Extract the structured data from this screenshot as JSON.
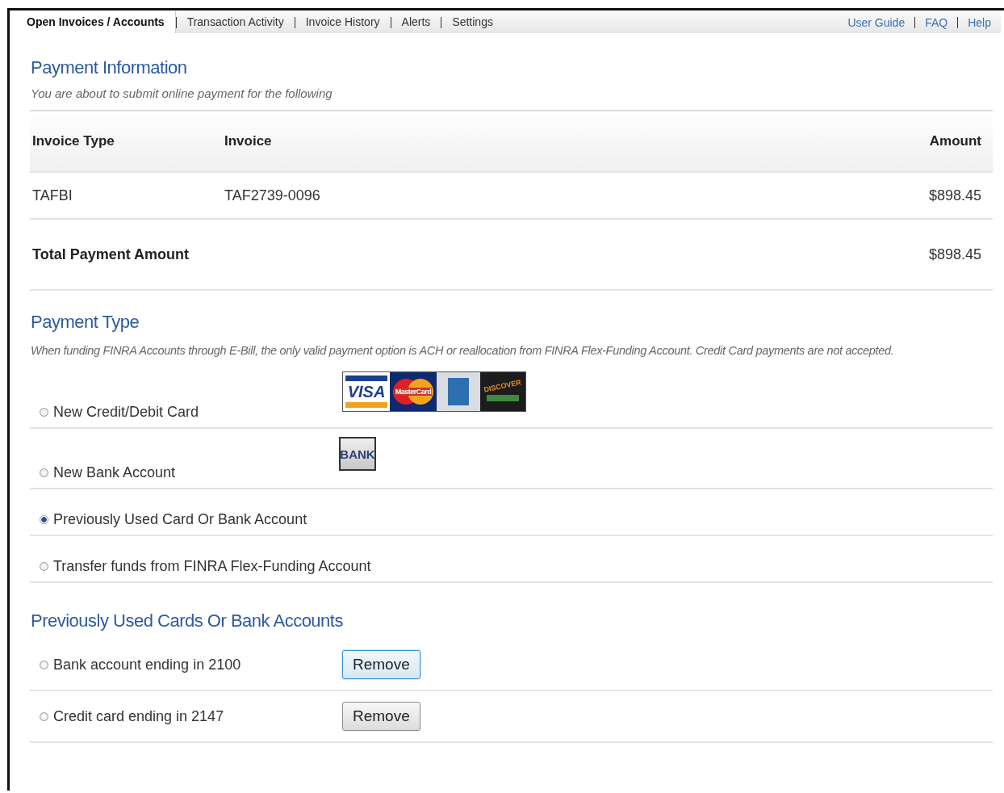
{
  "tabs": [
    {
      "label": "Open Invoices / Accounts",
      "selected": true
    },
    {
      "label": "Transaction Activity",
      "selected": false
    },
    {
      "label": "Invoice History",
      "selected": false
    },
    {
      "label": "Alerts",
      "selected": false
    },
    {
      "label": "Settings",
      "selected": false
    }
  ],
  "help_links": [
    "User Guide",
    "FAQ",
    "Help"
  ],
  "payment_information": {
    "title": "Payment Information",
    "subtitle": "You are about to submit online payment for the following",
    "table": {
      "columns": [
        "Invoice Type",
        "Invoice",
        "Amount"
      ],
      "rows": [
        [
          "TAFBI",
          "TAF2739-0096",
          "$898.45"
        ]
      ],
      "total": {
        "label": "Total Payment Amount",
        "amount": "$898.45"
      }
    }
  },
  "payment_type": {
    "title": "Payment Type",
    "note": "When funding FINRA Accounts through E-Bill, the only valid payment option is ACH or reallocation from FINRA Flex-Funding Account. Credit Card payments are not accepted.",
    "options": [
      {
        "label": "New Credit/Debit Card",
        "selected": false,
        "logos": [
          {
            "kind": "visa",
            "label": "VISA"
          },
          {
            "kind": "mastercard",
            "label": "MasterCard"
          },
          {
            "kind": "amex"
          },
          {
            "kind": "discover",
            "label": "DISCOVER"
          }
        ]
      },
      {
        "label": "New Bank Account",
        "selected": false,
        "logos": [
          {
            "kind": "bank",
            "label": "BANK"
          }
        ]
      },
      {
        "label": "Previously Used Card Or Bank Account",
        "selected": true
      },
      {
        "label": "Transfer funds from FINRA Flex-Funding Account",
        "selected": false
      }
    ]
  },
  "previous": {
    "title": "Previously Used Cards Or Bank Accounts",
    "items": [
      {
        "label": "Bank account ending in 2100",
        "selected": false,
        "button": "Remove",
        "focused": true
      },
      {
        "label": "Credit card ending in 2147",
        "selected": false,
        "button": "Remove",
        "focused": false
      }
    ]
  }
}
